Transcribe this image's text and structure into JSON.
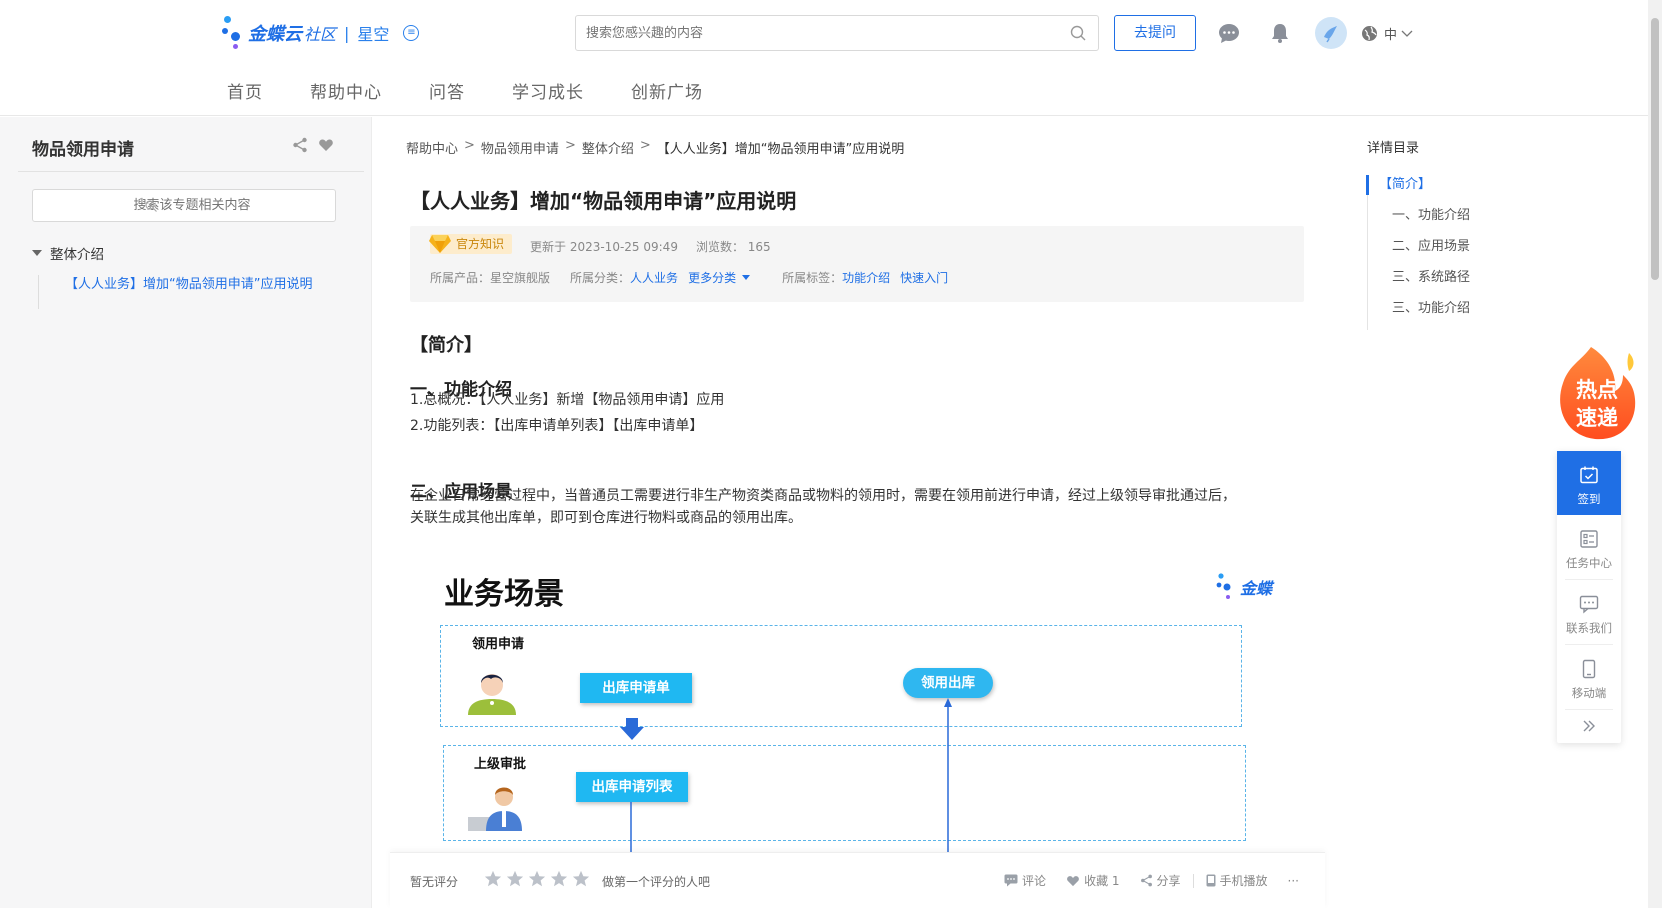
{
  "header": {
    "logo_text": "金蝶云",
    "logo_community": "社区",
    "logo_divider": "|",
    "logo_product": "星空",
    "search_placeholder": "搜索您感兴趣的内容",
    "ask_button": "去提问",
    "lang": "中",
    "nav": [
      "首页",
      "帮助中心",
      "问答",
      "学习成长",
      "创新广场"
    ]
  },
  "sidebar": {
    "title": "物品领用申请",
    "search_placeholder": "搜索该专题相关内容",
    "tree_root": "整体介绍",
    "tree_child": "【人人业务】增加“物品领用申请”应用说明"
  },
  "article": {
    "breadcrumb": [
      "帮助中心",
      "物品领用申请",
      "整体介绍",
      "【人人业务】增加“物品领用申请”应用说明"
    ],
    "breadcrumb_sep": ">",
    "title": "【人人业务】增加“物品领用申请”应用说明",
    "badge": "官方知识",
    "updated": "更新于 2023-10-25 09:49",
    "views": "浏览数：  165",
    "product_label": "所属产品：",
    "product_value": "星空旗舰版",
    "category_label": "所属分类：",
    "category_value": "人人业务",
    "more_category": "更多分类",
    "tags_label": "所属标签：",
    "tags": [
      "功能介绍",
      "快速入门"
    ],
    "intro_heading": "【简介】",
    "section1_heading": "一、功能介绍",
    "section1_lines": [
      "1.总概况：【人人业务】新增【物品领用申请】应用",
      "2.功能列表：【出库申请单列表】【出库申请单】"
    ],
    "section2_heading": "二、应用场景",
    "section2_lines": [
      "在企业日常经营过程中，当普通员工需要进行非生产物资类商品或物料的领用时，需要在领用前进行申请，经过上级领导审批通过后，",
      "关联生成其他出库单，即可到仓库进行物料或商品的领用出库。"
    ]
  },
  "diagram": {
    "title": "业务场景",
    "logo_text": "金蝶",
    "lane1_label": "领用申请",
    "lane2_label": "上级审批",
    "btn_apply": "出库申请单",
    "btn_list": "出库申请列表",
    "pill_outbound": "领用出库"
  },
  "bottom": {
    "rating_label": "暂无评分",
    "rating_hint": "做第一个评分的人吧",
    "comment": "评论",
    "favorite": "收藏 1",
    "share": "分享",
    "mobile": "手机播放",
    "more": "···"
  },
  "toc": {
    "title": "详情目录",
    "items": [
      "【简介】",
      "一、功能介绍",
      "二、应用场景",
      "三、系统路径",
      "三、功能介绍"
    ]
  },
  "floating": {
    "hot_line1": "热点",
    "hot_line2": "速递",
    "tools": [
      "签到",
      "任务中心",
      "联系我们",
      "移动端"
    ]
  },
  "colors": {
    "accent": "#1f6fe5",
    "diagram_button": "#1fb8f2",
    "badge_bg": "#fdeccc"
  }
}
